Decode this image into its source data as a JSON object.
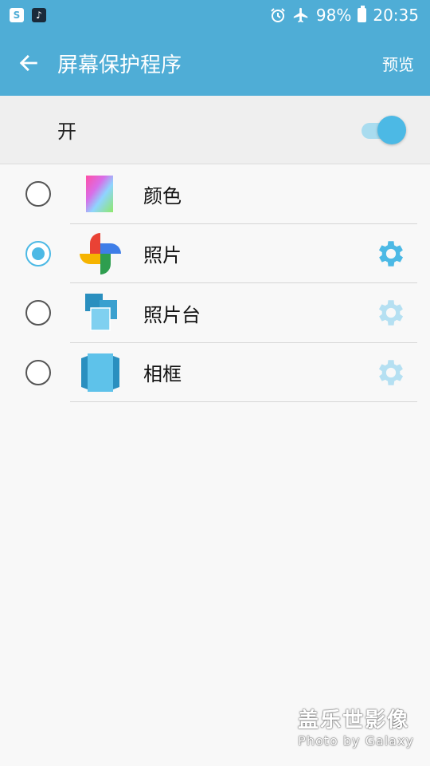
{
  "status_bar": {
    "left_icons": [
      {
        "name": "samsung-s-icon",
        "glyph": "S"
      },
      {
        "name": "tiktok-icon",
        "glyph": "♪"
      }
    ],
    "alarm_icon": "alarm-icon",
    "airplane_icon": "airplane-icon",
    "battery_percent": "98%",
    "time": "20:35"
  },
  "app_bar": {
    "title": "屏幕保护程序",
    "preview_label": "预览",
    "back_icon": "arrow-left-icon"
  },
  "master_switch": {
    "label": "开",
    "on": true,
    "track_color": "#a9dcef",
    "thumb_color": "#4cb9e5"
  },
  "options": [
    {
      "label": "颜色",
      "icon": "color-gradient-icon",
      "selected": false,
      "has_settings": false
    },
    {
      "label": "照片",
      "icon": "google-photos-pinwheel-icon",
      "selected": true,
      "has_settings": true,
      "settings_enabled": true
    },
    {
      "label": "照片台",
      "icon": "photo-table-icon",
      "selected": false,
      "has_settings": true,
      "settings_enabled": false
    },
    {
      "label": "相框",
      "icon": "photo-frame-icon",
      "selected": false,
      "has_settings": true,
      "settings_enabled": false
    }
  ],
  "colors": {
    "accent": "#4fadd6",
    "radio_selected": "#4cb9e5",
    "gear_active": "#4cb9e5",
    "gear_inactive": "#b5e0f2"
  },
  "watermark": {
    "main": "盖乐世影像",
    "sub": "Photo by Galaxy"
  }
}
